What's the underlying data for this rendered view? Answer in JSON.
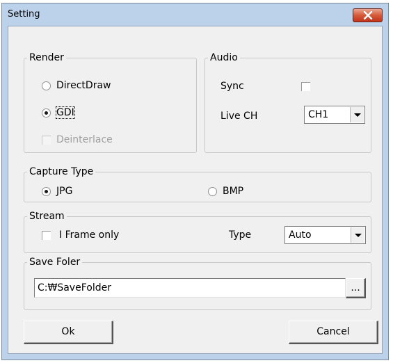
{
  "window": {
    "title": "Setting"
  },
  "render": {
    "legend": "Render",
    "directdraw_label": "DirectDraw",
    "gdi_label": "GDI",
    "deinterlace_label": "Deinterlace",
    "selected": "GDI"
  },
  "audio": {
    "legend": "Audio",
    "sync_label": "Sync",
    "sync_checked": false,
    "live_ch_label": "Live CH",
    "live_ch_value": "CH1"
  },
  "capture": {
    "legend": "Capture Type",
    "jpg_label": "JPG",
    "bmp_label": "BMP",
    "selected": "JPG"
  },
  "stream": {
    "legend": "Stream",
    "iframe_label": "I Frame only",
    "iframe_checked": false,
    "type_label": "Type",
    "type_value": "Auto"
  },
  "save": {
    "legend": "Save Foler",
    "path_value": "C:₩SaveFolder",
    "browse_label": "..."
  },
  "buttons": {
    "ok_label": "Ok",
    "cancel_label": "Cancel"
  },
  "icons": {
    "close": "close-x-icon",
    "combo_arrow": "chevron-down-icon"
  }
}
